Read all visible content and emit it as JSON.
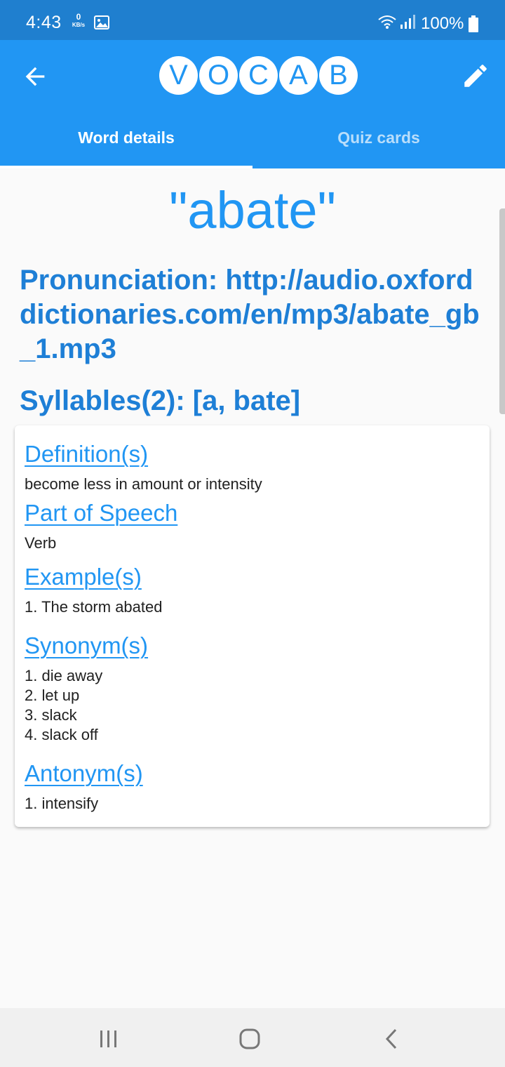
{
  "status_bar": {
    "time": "4:43",
    "net_speed_value": "0",
    "net_speed_unit": "KB/s",
    "battery": "100%",
    "icons": [
      "image-icon",
      "wifi-icon",
      "signal-icon",
      "battery-icon"
    ]
  },
  "app_bar": {
    "logo_letters": [
      "V",
      "O",
      "C",
      "A",
      "B"
    ],
    "back_icon": "arrow-back-icon",
    "edit_icon": "pencil-icon",
    "tabs": [
      {
        "label": "Word details",
        "selected": true
      },
      {
        "label": "Quiz cards",
        "selected": false
      }
    ]
  },
  "word": {
    "display": "\"abate\"",
    "pronunciation": "Pronunciation: http://audio.oxforddictionaries.com/en/mp3/abate_gb_1.mp3",
    "syllables": "Syllables(2): [a, bate]"
  },
  "details": {
    "definition_title": "Definition(s)",
    "definition_text": "become less in amount or intensity",
    "pos_title": "Part of Speech",
    "pos_text": "Verb",
    "examples_title": "Example(s)",
    "examples": [
      "1. The storm abated"
    ],
    "synonyms_title": "Synonym(s)",
    "synonyms": [
      "1. die away",
      "2. let up",
      "3. slack",
      "4. slack off"
    ],
    "antonyms_title": "Antonym(s)",
    "antonyms": [
      "1. intensify"
    ]
  },
  "nav_bar": {
    "icons": [
      "recents-icon",
      "home-icon",
      "back-icon"
    ]
  },
  "colors": {
    "status_bar": "#1f7fcf",
    "app_bar": "#2196f3",
    "accent_text": "#2196f3",
    "heading_text": "#1e7fd6",
    "background": "#fafafa"
  }
}
